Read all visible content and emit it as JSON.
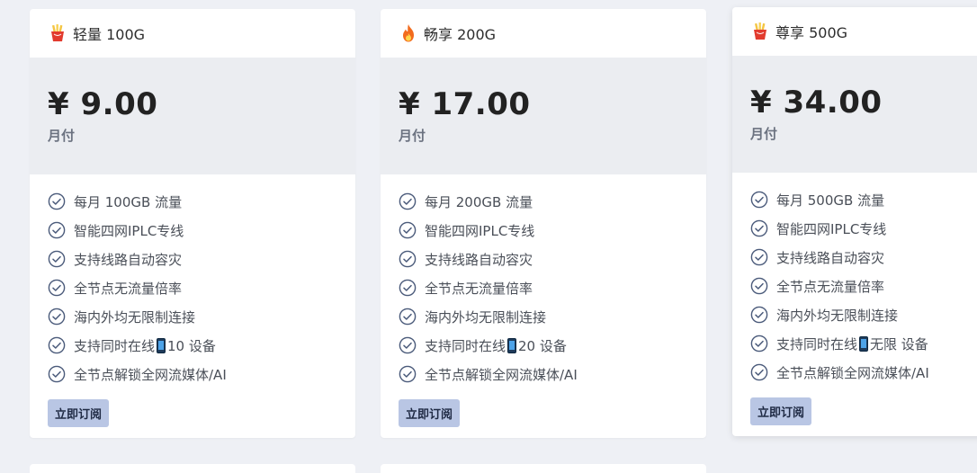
{
  "plans": [
    {
      "name": "轻量 100G",
      "icon": "fries-icon",
      "price": "¥ 9.00",
      "period": "月付",
      "features": [
        "每月 100GB 流量",
        "智能四网IPLC专线",
        "支持线路自动容灾",
        "全节点无流量倍率",
        "海内外均无限制连接",
        "支持同时在线",
        "全节点解锁全网流媒体/AI"
      ],
      "devices": "10 设备",
      "button": "立即订阅"
    },
    {
      "name": "畅享 200G",
      "icon": "fire-icon",
      "price": "¥ 17.00",
      "period": "月付",
      "features": [
        "每月 200GB 流量",
        "智能四网IPLC专线",
        "支持线路自动容灾",
        "全节点无流量倍率",
        "海内外均无限制连接",
        "支持同时在线",
        "全节点解锁全网流媒体/AI"
      ],
      "devices": "20 设备",
      "button": "立即订阅"
    },
    {
      "name": "尊享 500G",
      "icon": "fries-icon",
      "price": "¥ 34.00",
      "period": "月付",
      "features": [
        "每月 500GB 流量",
        "智能四网IPLC专线",
        "支持线路自动容灾",
        "全节点无流量倍率",
        "海内外均无限制连接",
        "支持同时在线",
        "全节点解锁全网流媒体/AI"
      ],
      "devices": "无限 设备",
      "button": "立即订阅"
    }
  ],
  "colors": {
    "background": "#eef0f5",
    "price_band": "#ebedf1",
    "button": "#b9c6e4",
    "check": "#4a5a7a"
  }
}
